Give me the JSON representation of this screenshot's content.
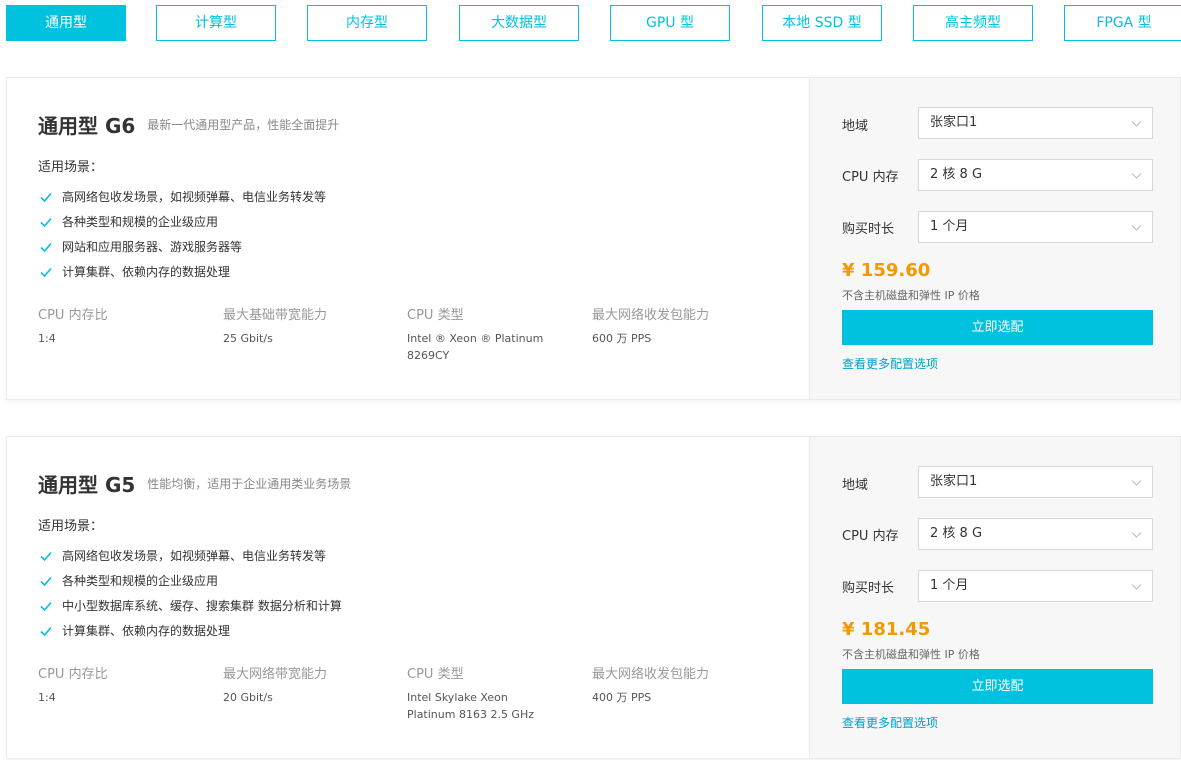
{
  "tabs": [
    {
      "label": "通用型",
      "active": true
    },
    {
      "label": "计算型"
    },
    {
      "label": "内存型"
    },
    {
      "label": "大数据型"
    },
    {
      "label": "GPU 型"
    },
    {
      "label": "本地 SSD 型"
    },
    {
      "label": "高主频型"
    },
    {
      "label": "FPGA 型"
    }
  ],
  "colors": {
    "accent": "#00c1de",
    "price": "#f39800",
    "link": "#00a2ca"
  },
  "icons": {
    "check": "check-icon",
    "dropdown": "chevron-down-icon"
  },
  "cards": [
    {
      "title": "通用型 G6",
      "subtitle": "最新一代通用型产品，性能全面提升",
      "scenarios_label": "适用场景：",
      "scenarios": [
        "高网络包收发场景，如视频弹幕、电信业务转发等",
        "各种类型和规模的企业级应用",
        "网站和应用服务器、游戏服务器等",
        "计算集群、依赖内存的数据处理"
      ],
      "specs": [
        {
          "label": "CPU 内存比",
          "value": "1:4"
        },
        {
          "label": "最大基础带宽能力",
          "value": "25 Gbit/s"
        },
        {
          "label": "CPU 类型",
          "value": "Intel ® Xeon ® Platinum\n8269CY"
        },
        {
          "label": "最大网络收发包能力",
          "value": "600 万 PPS"
        }
      ],
      "region_label": "地域",
      "region_value": "张家口1",
      "cpu_label": "CPU 内存",
      "cpu_value": "2 核 8 G",
      "duration_label": "购买时长",
      "duration_value": "1 个月",
      "price": "¥ 159.60",
      "price_note": "不含主机磁盘和弹性 IP 价格",
      "buy_label": "立即选配",
      "more_label": "查看更多配置选项"
    },
    {
      "title": "通用型 G5",
      "subtitle": "性能均衡，适用于企业通用类业务场景",
      "scenarios_label": "适用场景：",
      "scenarios": [
        "高网络包收发场景，如视频弹幕、电信业务转发等",
        "各种类型和规模的企业级应用",
        "中小型数据库系统、缓存、搜索集群 数据分析和计算",
        "计算集群、依赖内存的数据处理"
      ],
      "specs": [
        {
          "label": "CPU 内存比",
          "value": "1:4"
        },
        {
          "label": "最大网络带宽能力",
          "value": "20 Gbit/s"
        },
        {
          "label": "CPU 类型",
          "value": "Intel Skylake Xeon\nPlatinum 8163 2.5 GHz"
        },
        {
          "label": "最大网络收发包能力",
          "value": "400 万 PPS"
        }
      ],
      "region_label": "地域",
      "region_value": "张家口1",
      "cpu_label": "CPU 内存",
      "cpu_value": "2 核 8 G",
      "duration_label": "购买时长",
      "duration_value": "1 个月",
      "price": "¥ 181.45",
      "price_note": "不含主机磁盘和弹性 IP 价格",
      "buy_label": "立即选配",
      "more_label": "查看更多配置选项"
    }
  ]
}
